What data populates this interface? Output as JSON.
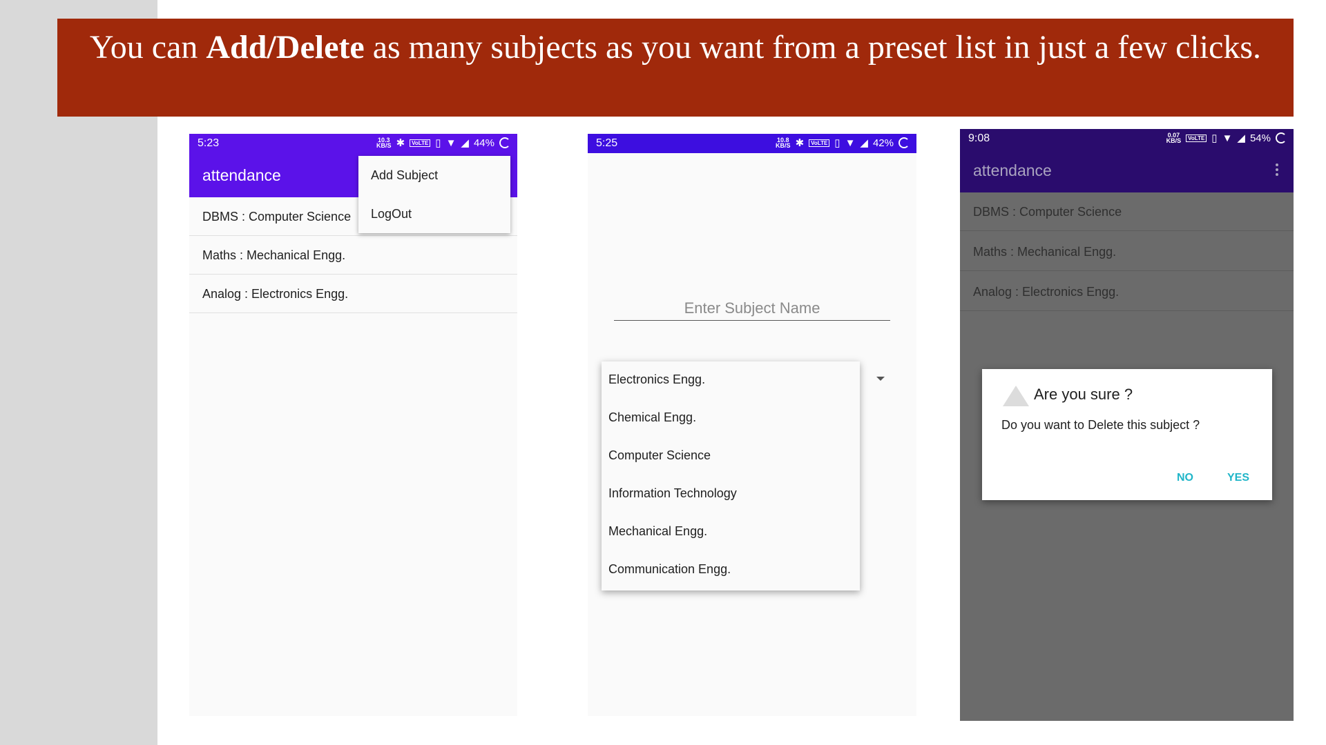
{
  "banner": {
    "pre": "You can ",
    "bold": "Add/Delete",
    "post": " as many subjects as you want from a preset list in just a few clicks."
  },
  "phone1": {
    "status": {
      "time": "5:23",
      "speed_top": "10.3",
      "speed_unit": "KB/S",
      "vlte": "VoLTE",
      "battery": "44%"
    },
    "app_title": "attendance",
    "rows": [
      "DBMS : Computer Science",
      "Maths : Mechanical Engg.",
      "Analog : Electronics Engg."
    ],
    "menu": [
      "Add Subject",
      "LogOut"
    ]
  },
  "phone2": {
    "status": {
      "time": "5:25",
      "speed_top": "10.8",
      "speed_unit": "KB/S",
      "vlte": "VoLTE",
      "battery": "42%"
    },
    "placeholder": "Enter Subject Name",
    "options": [
      "Electronics Engg.",
      "Chemical Engg.",
      "Computer Science",
      "Information Technology",
      "Mechanical Engg.",
      "Communication Engg."
    ]
  },
  "phone3": {
    "status": {
      "time": "9:08",
      "speed_top": "0.07",
      "speed_unit": "KB/S",
      "vlte": "VoLTE",
      "battery": "54%"
    },
    "app_title": "attendance",
    "rows": [
      "DBMS : Computer Science",
      "Maths : Mechanical Engg.",
      "Analog : Electronics Engg."
    ],
    "dialog": {
      "title": "Are you sure ?",
      "message": "Do you want to Delete this subject ?",
      "no": "NO",
      "yes": "YES"
    }
  },
  "colors": {
    "banner": "#a0290b",
    "appbar_phone1": "#5b12e9",
    "status_phone2": "#3d0ee0",
    "appbar_phone3_dimmed": "#2a0c6d",
    "dialog_button": "#1fb5c8"
  }
}
